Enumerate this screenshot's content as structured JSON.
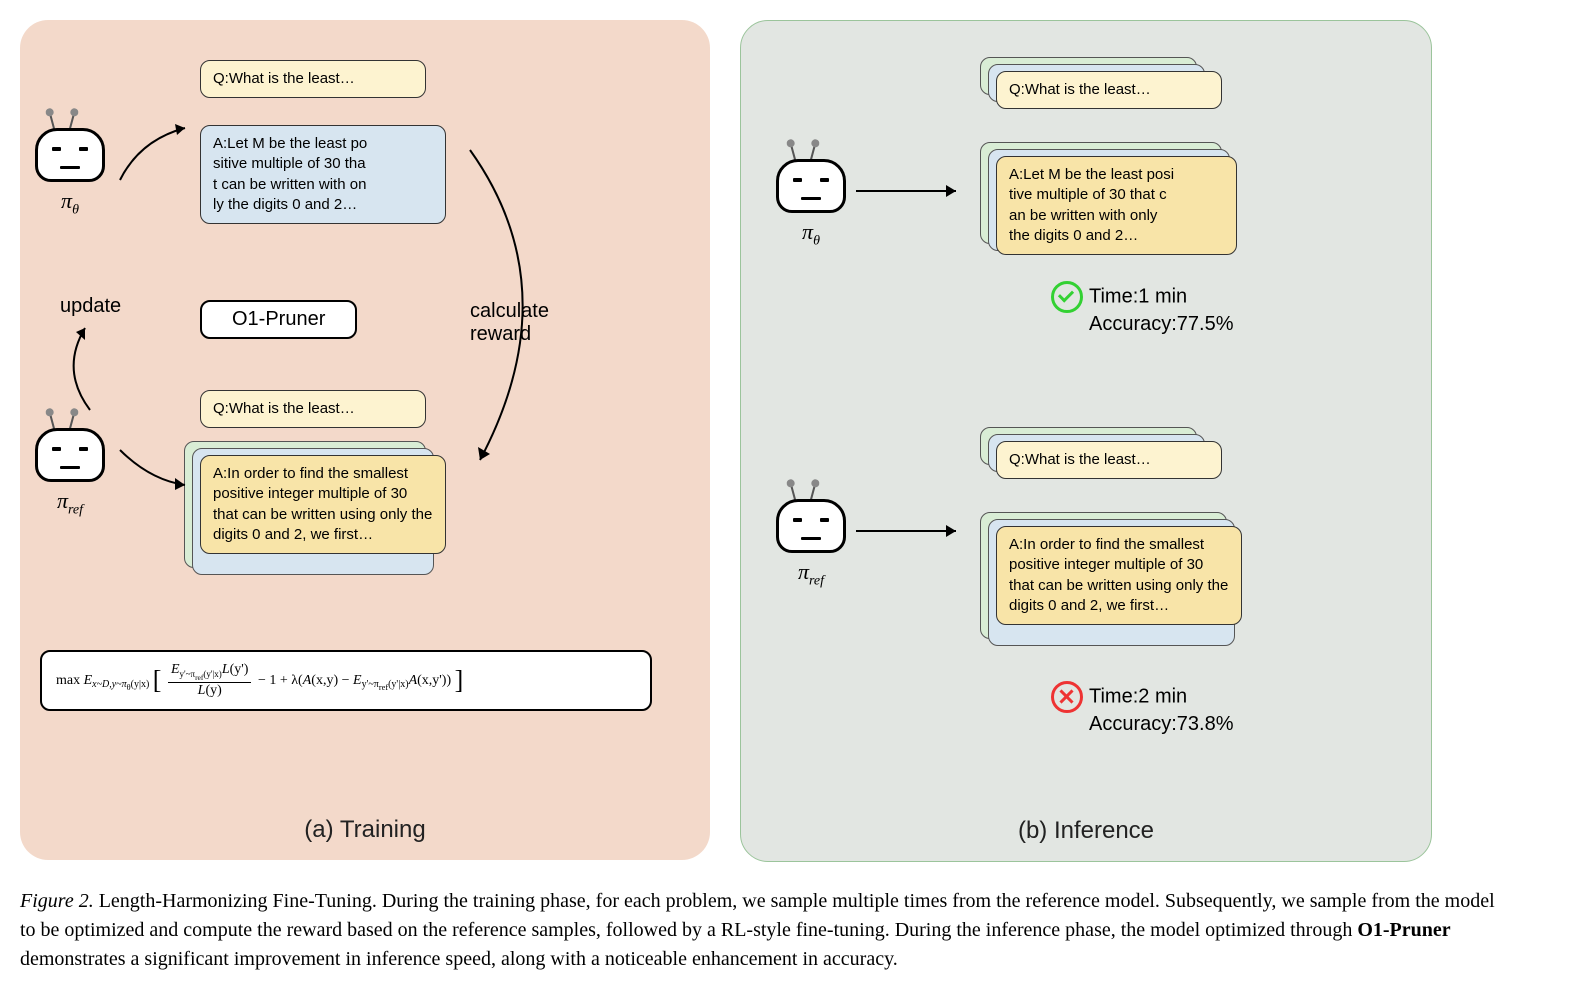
{
  "panelA": {
    "title": "(a) Training",
    "robot1_label": "π<sub>θ</sub>",
    "robot2_label": "π<sub>ref</sub>",
    "q1": "Q:What is the least…",
    "a1": "A:Let M be the least po\nsitive multiple of 30 tha\nt can be written with on\nly the digits 0 and 2…",
    "pruner": "O1-Pruner",
    "q2": "Q:What is the least…",
    "a2": "A:In order to find the smallest positive integer multiple of 30 that can be written using only the digits 0 and 2, we first…",
    "update_label": "update",
    "reward_label": "calculate\nreward",
    "formula": {
      "prefix": "max E",
      "sub1": "x~D,y~π",
      "sub1b": "θ",
      "sub1c": "(y|x)",
      "bracket_l": "[",
      "frac_num": "E<sub>y'~π<sub>ref</sub>(y'|x)</sub>L(y')",
      "frac_den": "L(y)",
      "mid": " − 1 + λ(A(x,y) − E",
      "sub2": "y'~π",
      "sub2b": "ref",
      "sub2c": "(y'|x)",
      "end": "A(x,y'))",
      "bracket_r": "]"
    }
  },
  "panelB": {
    "title": "(b) Inference",
    "robot1_label": "π<sub>θ</sub>",
    "robot2_label": "π<sub>ref</sub>",
    "q1": "Q:What is the least…",
    "a1": "A:Let M be the least posi\ntive multiple of 30 that c\nan be written with only\nthe digits 0 and 2…",
    "result1_time": "Time:1 min",
    "result1_acc": "Accuracy:77.5%",
    "q2": "Q:What is the least…",
    "a2": "A:In order to find the smallest positive integer multiple of 30 that can be written using only the digits 0 and 2, we first…",
    "result2_time": "Time:2 min",
    "result2_acc": "Accuracy:73.8%"
  },
  "caption": {
    "label": "Figure 2.",
    "text": " Length-Harmonizing Fine-Tuning. During the training phase, for each problem, we sample multiple times from the reference model. Subsequently, we sample from the model to be optimized and compute the reward based on the reference samples, followed by a RL-style fine-tuning. During the inference phase, the model optimized through ",
    "bold": "O1-Pruner",
    "text2": " demonstrates a significant improvement in inference speed, along with a noticeable enhancement in accuracy."
  }
}
